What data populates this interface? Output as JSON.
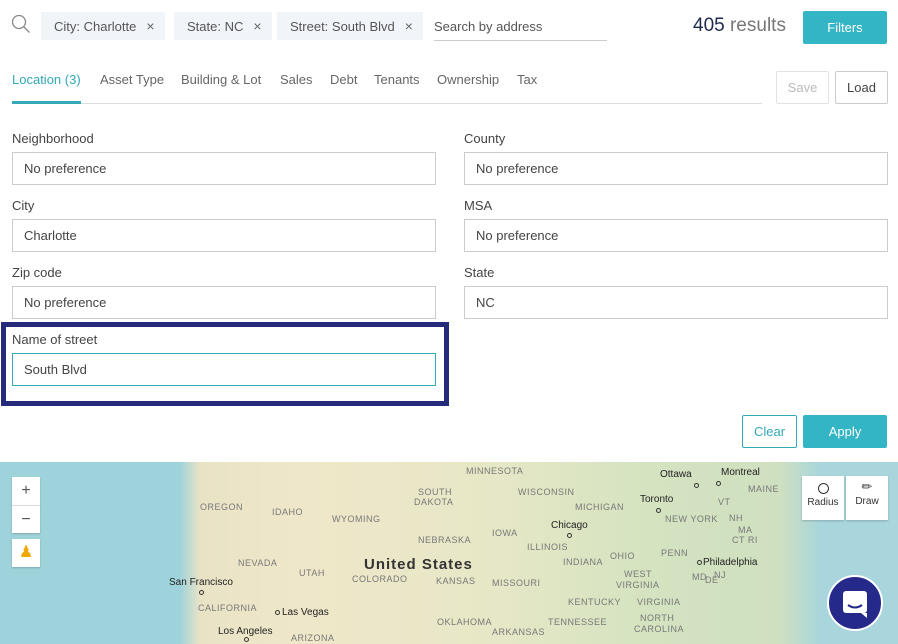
{
  "search": {
    "placeholder": "Search by address",
    "icon": "search-icon"
  },
  "chips": [
    {
      "label": "City: Charlotte"
    },
    {
      "label": "State: NC"
    },
    {
      "label": "Street: South Blvd"
    }
  ],
  "chip_close": "×",
  "results": {
    "count": "405",
    "label": "results"
  },
  "filters_button": "Filters",
  "tabs": [
    {
      "label": "Location (3)",
      "active": true
    },
    {
      "label": "Asset Type"
    },
    {
      "label": "Building & Lot"
    },
    {
      "label": "Sales"
    },
    {
      "label": "Debt"
    },
    {
      "label": "Tenants"
    },
    {
      "label": "Ownership"
    },
    {
      "label": "Tax"
    }
  ],
  "save_label": "Save",
  "load_label": "Load",
  "fields": {
    "neighborhood": {
      "label": "Neighborhood",
      "value": "No preference"
    },
    "county": {
      "label": "County",
      "value": "No preference"
    },
    "city": {
      "label": "City",
      "value": "Charlotte"
    },
    "msa": {
      "label": "MSA",
      "value": "No preference"
    },
    "zip": {
      "label": "Zip code",
      "value": "No preference"
    },
    "state": {
      "label": "State",
      "value": "NC"
    },
    "street": {
      "label": "Name of street",
      "value": "South Blvd"
    }
  },
  "clear_label": "Clear",
  "apply_label": "Apply",
  "map": {
    "zoom_in": "+",
    "zoom_out": "−",
    "radius": "Radius",
    "draw": "Draw",
    "country": "United States",
    "states": [
      "MINNESOTA",
      "SOUTH",
      "DAKOTA",
      "WISCONSIN",
      "MICHIGAN",
      "OREGON",
      "IDAHO",
      "WYOMING",
      "IOWA",
      "NEBRASKA",
      "ILLINOIS",
      "OHIO",
      "PENN",
      "NEVADA",
      "UTAH",
      "COLORADO",
      "KANSAS",
      "MISSOURI",
      "INDIANA",
      "WEST",
      "VIRGINIA",
      "KENTUCKY",
      "VIRGINIA",
      "CALIFORNIA",
      "OKLAHOMA",
      "TENNESSEE",
      "NORTH",
      "CAROLINA",
      "ARKANSAS",
      "ARIZONA",
      "MAINE",
      "VT",
      "NH",
      "NEW YORK",
      "MA",
      "CT RI",
      "MD",
      "DE",
      "NJ"
    ],
    "cities": [
      "Ottawa",
      "Montreal",
      "Toronto",
      "Chicago",
      "Philadelphia",
      "San Francisco",
      "Las Vegas",
      "Los Angeles"
    ]
  },
  "colors": {
    "accent": "#33b5c6",
    "highlight": "#252a7a",
    "count": "#1f2a4d"
  }
}
